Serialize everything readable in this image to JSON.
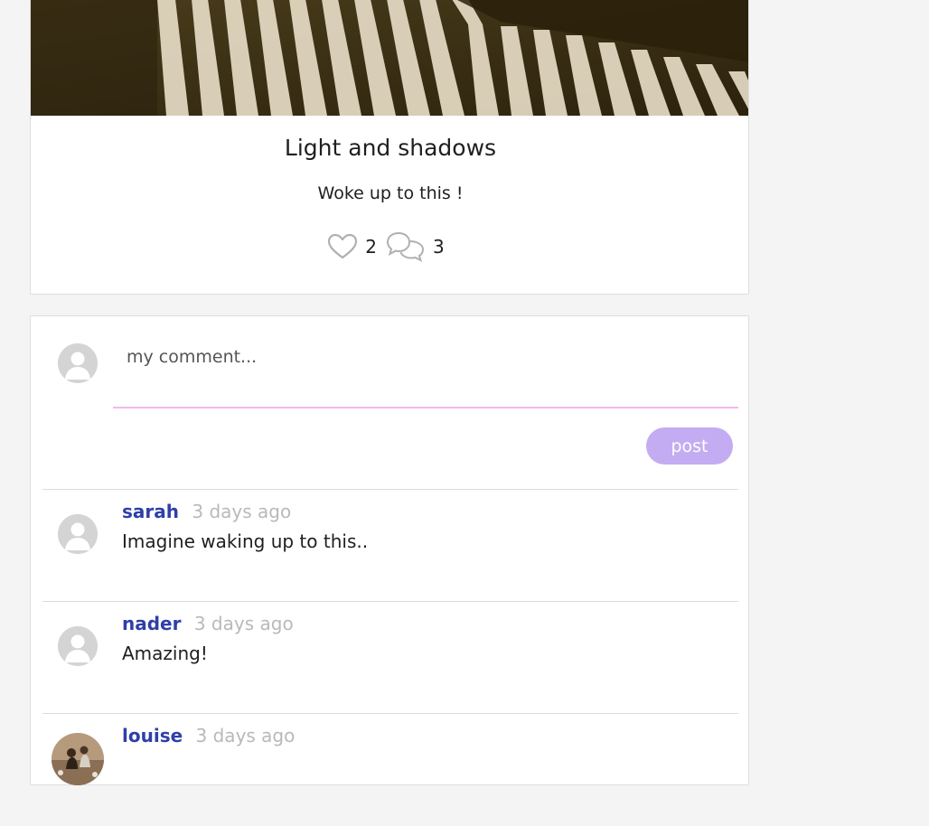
{
  "post": {
    "title": "Light and shadows",
    "description": "Woke up to this !",
    "likes": "2",
    "comments": "3",
    "like_icon": "heart-icon",
    "comment_icon": "speech-bubbles-icon"
  },
  "comment_form": {
    "placeholder": "my comment...",
    "post_label": "post"
  },
  "comments": [
    {
      "author": "sarah",
      "time": "3 days ago",
      "text": "Imagine waking up to this.."
    },
    {
      "author": "nader",
      "time": "3 days ago",
      "text": "Amazing!"
    },
    {
      "author": "louise",
      "time": "3 days ago",
      "text": ""
    }
  ],
  "colors": {
    "author": "#2f3fa8",
    "timestamp": "#b9b9b9",
    "post_button": "#c3acf2",
    "input_underline": "#f1b8f0"
  }
}
